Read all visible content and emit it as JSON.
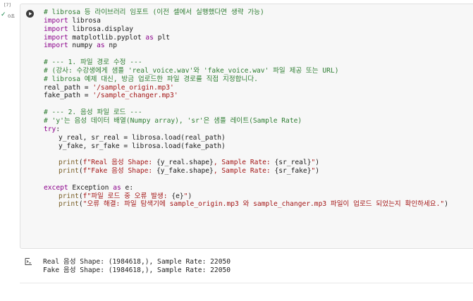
{
  "cell": {
    "exec_count": "[7]",
    "exec_time": "0초"
  },
  "code": [
    {
      "parts": [
        {
          "c": "cm",
          "t": "# librosa 등 라이브러리 임포트 (이전 셀에서 실행했다면 생략 가능)"
        }
      ]
    },
    {
      "parts": [
        {
          "c": "kw",
          "t": "import"
        },
        {
          "c": "pl",
          "t": " librosa"
        }
      ]
    },
    {
      "parts": [
        {
          "c": "kw",
          "t": "import"
        },
        {
          "c": "pl",
          "t": " librosa.display"
        }
      ]
    },
    {
      "parts": [
        {
          "c": "kw",
          "t": "import"
        },
        {
          "c": "pl",
          "t": " matplotlib.pyplot "
        },
        {
          "c": "kw",
          "t": "as"
        },
        {
          "c": "pl",
          "t": " plt"
        }
      ]
    },
    {
      "parts": [
        {
          "c": "kw",
          "t": "import"
        },
        {
          "c": "pl",
          "t": " numpy "
        },
        {
          "c": "kw",
          "t": "as"
        },
        {
          "c": "pl",
          "t": " np"
        }
      ]
    },
    {
      "parts": []
    },
    {
      "parts": [
        {
          "c": "cm",
          "t": "# --- 1. 파일 경로 수정 ---"
        }
      ]
    },
    {
      "parts": [
        {
          "c": "cm",
          "t": "# (강사: 수강생에게 샘플 'real_voice.wav'와 'fake_voice.wav' 파일 제공 또는 URL)"
        }
      ]
    },
    {
      "parts": [
        {
          "c": "cm",
          "t": "# librosa 예제 대신, 방금 업로드한 파일 경로를 직접 지정합니다."
        }
      ]
    },
    {
      "parts": [
        {
          "c": "pl",
          "t": "real_path = "
        },
        {
          "c": "st",
          "t": "'/sample_origin.mp3'"
        }
      ]
    },
    {
      "parts": [
        {
          "c": "pl",
          "t": "fake_path = "
        },
        {
          "c": "st",
          "t": "'/sample_changer.mp3'"
        }
      ]
    },
    {
      "parts": []
    },
    {
      "parts": [
        {
          "c": "cm",
          "t": "# --- 2. 음성 파일 로드 ---"
        }
      ]
    },
    {
      "parts": [
        {
          "c": "cm",
          "t": "# 'y'는 음성 데이터 배열(Numpy array), 'sr'은 샘플 레이트(Sample Rate)"
        }
      ]
    },
    {
      "parts": [
        {
          "c": "kw",
          "t": "try"
        },
        {
          "c": "pl",
          "t": ":"
        }
      ]
    },
    {
      "indent": 1,
      "parts": [
        {
          "c": "pl",
          "t": "y_real, sr_real = librosa.load(real_path)"
        }
      ]
    },
    {
      "indent": 1,
      "parts": [
        {
          "c": "pl",
          "t": "y_fake, sr_fake = librosa.load(fake_path)"
        }
      ]
    },
    {
      "parts": []
    },
    {
      "indent": 1,
      "parts": [
        {
          "c": "bi",
          "t": "print"
        },
        {
          "c": "pl",
          "t": "("
        },
        {
          "c": "st",
          "t": "f\"Real 음성 Shape: "
        },
        {
          "c": "pl",
          "t": "{y_real.shape}"
        },
        {
          "c": "st",
          "t": ", Sample Rate: "
        },
        {
          "c": "pl",
          "t": "{sr_real}"
        },
        {
          "c": "st",
          "t": "\""
        },
        {
          "c": "pl",
          "t": ")"
        }
      ]
    },
    {
      "indent": 1,
      "parts": [
        {
          "c": "bi",
          "t": "print"
        },
        {
          "c": "pl",
          "t": "("
        },
        {
          "c": "st",
          "t": "f\"Fake 음성 Shape: "
        },
        {
          "c": "pl",
          "t": "{y_fake.shape}"
        },
        {
          "c": "st",
          "t": ", Sample Rate: "
        },
        {
          "c": "pl",
          "t": "{sr_fake}"
        },
        {
          "c": "st",
          "t": "\""
        },
        {
          "c": "pl",
          "t": ")"
        }
      ]
    },
    {
      "parts": []
    },
    {
      "parts": [
        {
          "c": "kw",
          "t": "except"
        },
        {
          "c": "pl",
          "t": " Exception "
        },
        {
          "c": "kw",
          "t": "as"
        },
        {
          "c": "pl",
          "t": " e:"
        }
      ]
    },
    {
      "indent": 1,
      "parts": [
        {
          "c": "bi",
          "t": "print"
        },
        {
          "c": "pl",
          "t": "("
        },
        {
          "c": "st",
          "t": "f\"파일 로드 중 오류 발생: "
        },
        {
          "c": "pl",
          "t": "{e}"
        },
        {
          "c": "st",
          "t": "\""
        },
        {
          "c": "pl",
          "t": ")"
        }
      ]
    },
    {
      "indent": 1,
      "parts": [
        {
          "c": "bi",
          "t": "print"
        },
        {
          "c": "pl",
          "t": "("
        },
        {
          "c": "st",
          "t": "\"오류 해결: 파일 탐색기에 sample_origin.mp3 와 sample_changer.mp3 파일이 업로드 되었는지 확인하세요.\""
        },
        {
          "c": "pl",
          "t": ")"
        }
      ]
    }
  ],
  "output": {
    "icon": "output-toggle-icon",
    "lines": [
      "Real 음성 Shape: (1984618,), Sample Rate: 22050",
      "Fake 음성 Shape: (1984618,), Sample Rate: 22050"
    ]
  }
}
